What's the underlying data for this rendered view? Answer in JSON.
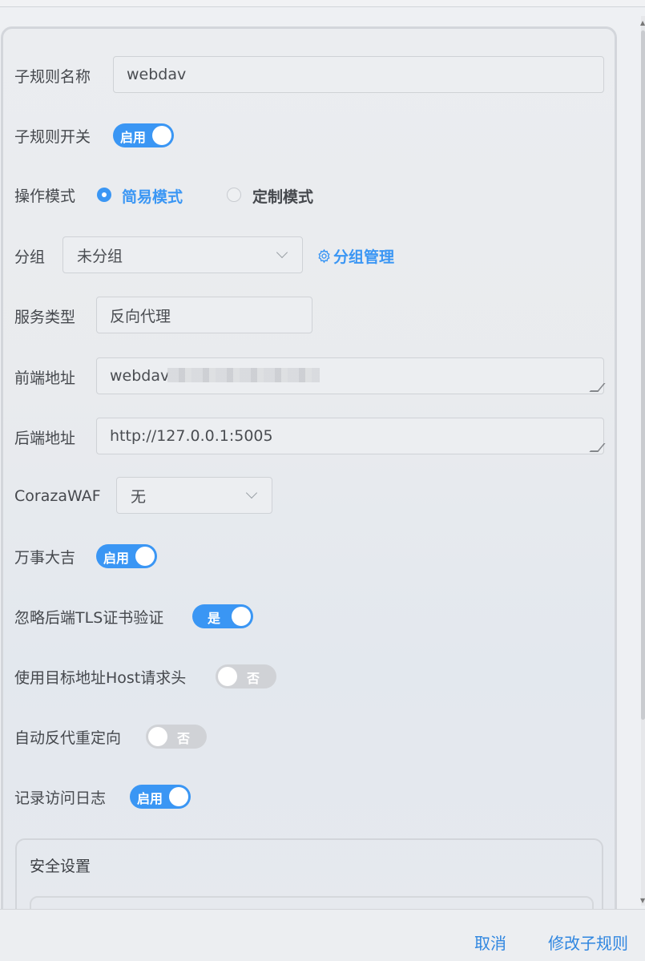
{
  "form": {
    "name_label": "子规则名称",
    "name_value": "webdav",
    "switch_label": "子规则开关",
    "switch_text": "启用",
    "mode_label": "操作模式",
    "mode_simple": "简易模式",
    "mode_custom": "定制模式",
    "group_label": "分组",
    "group_value": "未分组",
    "group_manage": "分组管理",
    "service_label": "服务类型",
    "service_value": "反向代理",
    "frontend_label": "前端地址",
    "frontend_value": "webdav",
    "backend_label": "后端地址",
    "backend_value": "http://127.0.0.1:5005",
    "waf_label": "CorazaWAF",
    "waf_value": "无",
    "lucky_label": "万事大吉",
    "lucky_text": "启用",
    "tls_label": "忽略后端TLS证书验证",
    "tls_text": "是",
    "host_label": "使用目标地址Host请求头",
    "host_text": "否",
    "redirect_label": "自动反代重定向",
    "redirect_text": "否",
    "log_label": "记录访问日志",
    "log_text": "启用"
  },
  "security": {
    "title": "安全设置"
  },
  "footer": {
    "cancel": "取消",
    "submit": "修改子规则"
  },
  "colors": {
    "accent": "#3a96f4",
    "toggle_off": "#d0d2d6"
  }
}
